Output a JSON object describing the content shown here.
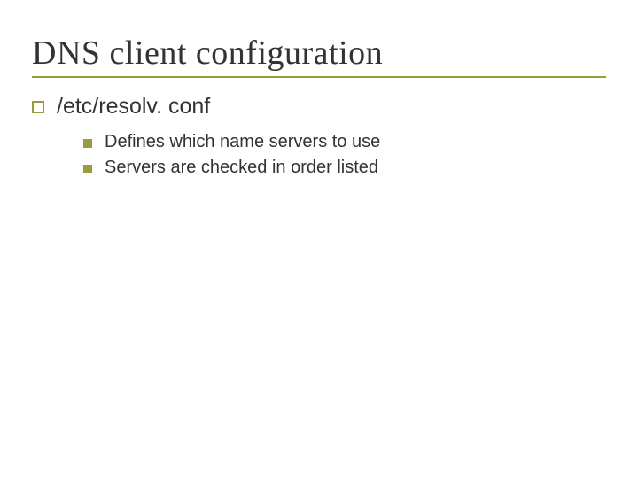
{
  "slide": {
    "title": "DNS client configuration",
    "bullets": {
      "level1": [
        {
          "text": "/etc/resolv. conf",
          "sub": [
            "Defines which name servers to use",
            "Servers are checked in order listed"
          ]
        }
      ]
    }
  },
  "colors": {
    "accent": "#9a9a3f",
    "text": "#333333"
  }
}
